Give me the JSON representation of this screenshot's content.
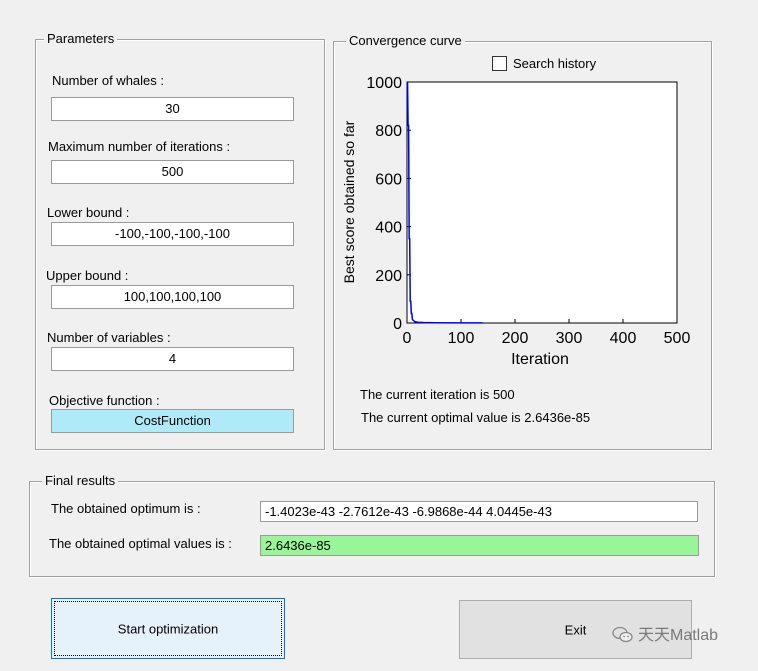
{
  "parameters": {
    "title": "Parameters",
    "whales_label": "Number of whales :",
    "whales_value": "30",
    "iterations_label": "Maximum number of iterations :",
    "iterations_value": "500",
    "lower_label": "Lower bound :",
    "lower_value": "-100,-100,-100,-100",
    "upper_label": "Upper bound :",
    "upper_value": "100,100,100,100",
    "variables_label": "Number of variables :",
    "variables_value": "4",
    "objective_label": "Objective function :",
    "objective_value": "CostFunction",
    "objective_color": "#aeeaf8"
  },
  "convergence": {
    "title": "Convergence curve",
    "search_history_label": "Search history",
    "search_history_checked": false,
    "current_iteration_text": "The current iteration is 500",
    "current_optimal_text": "The current optimal value is 2.6436e-85"
  },
  "chart_data": {
    "type": "line",
    "xlabel": "Iteration",
    "ylabel": "Best score obtained so far",
    "xlim": [
      0,
      500
    ],
    "ylim": [
      0,
      1000
    ],
    "xticks": [
      "0",
      "100",
      "200",
      "300",
      "400",
      "500"
    ],
    "yticks": [
      "0",
      "200",
      "400",
      "600",
      "800",
      "1000"
    ],
    "line_color": "#0000ff",
    "series": [
      {
        "x": [
          1,
          2,
          3,
          4,
          5,
          6,
          7,
          8,
          9,
          10,
          12,
          15,
          20,
          30,
          50,
          100,
          140
        ],
        "y": [
          1000,
          820,
          820,
          350,
          350,
          90,
          90,
          40,
          40,
          15,
          10,
          5,
          3,
          2,
          1,
          0.5,
          0.3
        ]
      }
    ]
  },
  "final": {
    "title": "Final results",
    "optimum_label": "The obtained optimum is :",
    "optimum_value": "-1.4023e-43 -2.7612e-43 -6.9868e-44  4.0445e-43",
    "optimal_values_label": "The obtained optimal values is :",
    "optimal_values_value": "2.6436e-85",
    "optimal_values_color": "#98f598"
  },
  "buttons": {
    "start_label": "Start optimization",
    "exit_label": "Exit"
  },
  "watermark": {
    "text": "天天Matlab",
    "icon": "wechat-icon"
  }
}
